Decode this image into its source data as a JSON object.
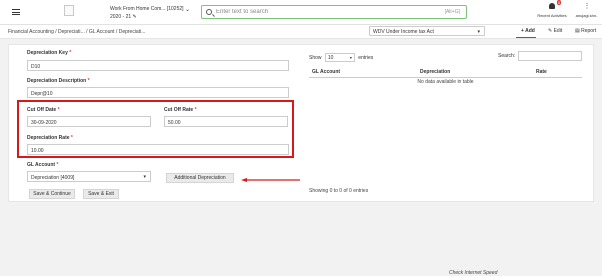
{
  "topbar": {
    "company_line1": "Work From Home Com... [10252]",
    "company_line2": "2020 - 21",
    "search_placeholder": "Enter text to search",
    "search_shortcut": "[Alt+G]",
    "activity_badge": "0",
    "activity_label": "Recent Activities",
    "user_label": "anujagi.shn.."
  },
  "subbar": {
    "breadcrumb": "Financial Accounting  / Depreciati... / GL Account / Depreciati...",
    "method_select": "WDV Under Income tax Act",
    "add_label": "Add",
    "edit_label": "Edit",
    "report_label": "Report"
  },
  "form": {
    "dep_key_label": "Depreciation Key",
    "dep_key_value": "D10",
    "dep_desc_label": "Depreciation Description",
    "dep_desc_value": "Depr@10",
    "cutoff_date_label": "Cut Off Date",
    "cutoff_date_value": "30-09-2020",
    "cutoff_rate_label": "Cut Off Rate",
    "cutoff_rate_value": "50.00",
    "dep_rate_label": "Depreciation Rate",
    "dep_rate_value": "10.00",
    "gl_account_label": "GL Account",
    "gl_account_value": "Depreciation [4009]",
    "additional_dep_label": "Additional Depreciation",
    "save_continue_label": "Save & Continue",
    "save_exit_label": "Save & Exit",
    "required_mark": "*"
  },
  "table": {
    "show_label": "Show",
    "entries_label": "entries",
    "page_size": "10",
    "search_label": "Search:",
    "columns": [
      "GL Account",
      "Depreciation",
      "Rate"
    ],
    "empty_text": "No data available in table",
    "showing_text": "Showing 0 to 0 of 0 entries"
  },
  "footer": {
    "link": "Check Internet Speed"
  },
  "colors": {
    "highlight": "#d6191b",
    "search_border": "#7fc27b",
    "add_underline": "#2e7d32"
  }
}
